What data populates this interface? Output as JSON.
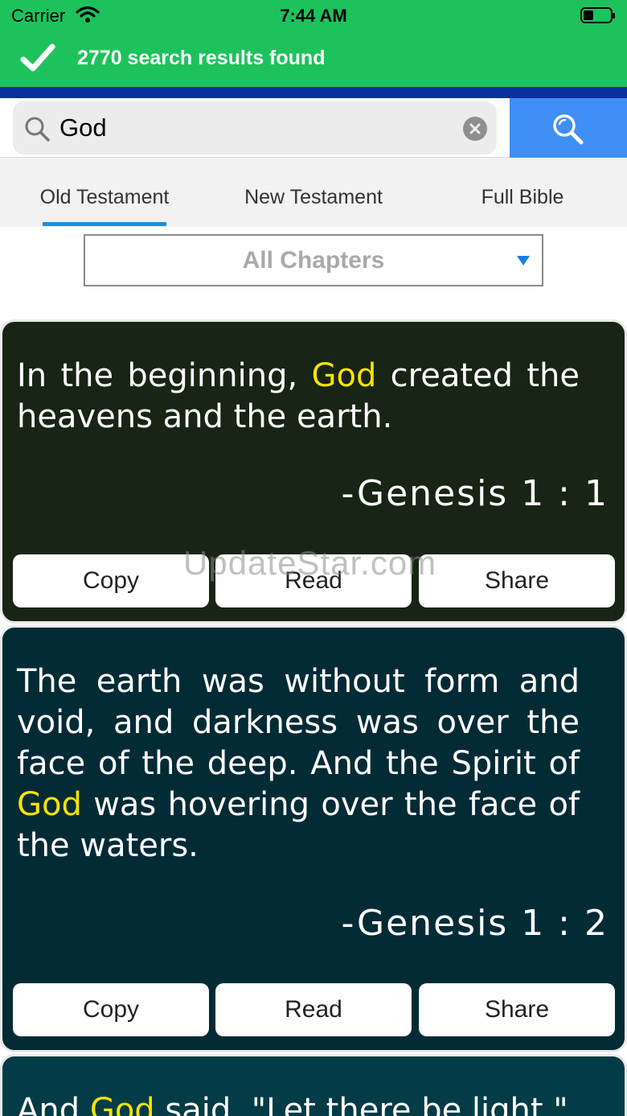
{
  "status_bar": {
    "carrier": "Carrier",
    "time": "7:44 AM"
  },
  "banner": {
    "message": "2770 search results found",
    "color": "#1ec25c"
  },
  "search": {
    "query": "God"
  },
  "tabs": [
    {
      "label": "Old Testament",
      "active": true
    },
    {
      "label": "New Testament",
      "active": false
    },
    {
      "label": "Full Bible",
      "active": false
    }
  ],
  "chapter_filter": {
    "selected": "All Chapters"
  },
  "results": [
    {
      "text_before": "In the beginning, ",
      "highlight": "God",
      "text_after": " created the heavens and the earth.",
      "reference": "-Genesis 1 : 1",
      "background": "#182414"
    },
    {
      "text_before": "The earth was without form and void, and darkness was over the face of the deep. And the Spirit of ",
      "highlight": "God",
      "text_after": " was hovering over the face of the waters.",
      "reference": "-Genesis 1 : 2",
      "background": "#032b36"
    },
    {
      "text_before": "And ",
      "highlight": "God",
      "text_after": " said, \"Let there be light,\"",
      "background": "#033c46"
    }
  ],
  "actions": {
    "copy": "Copy",
    "read": "Read",
    "share": "Share"
  },
  "watermark": "UpdateStar.com",
  "colors": {
    "highlight": "#f5e400",
    "search_button": "#3f8ff5",
    "tab_indicator": "#1a8fe3"
  }
}
